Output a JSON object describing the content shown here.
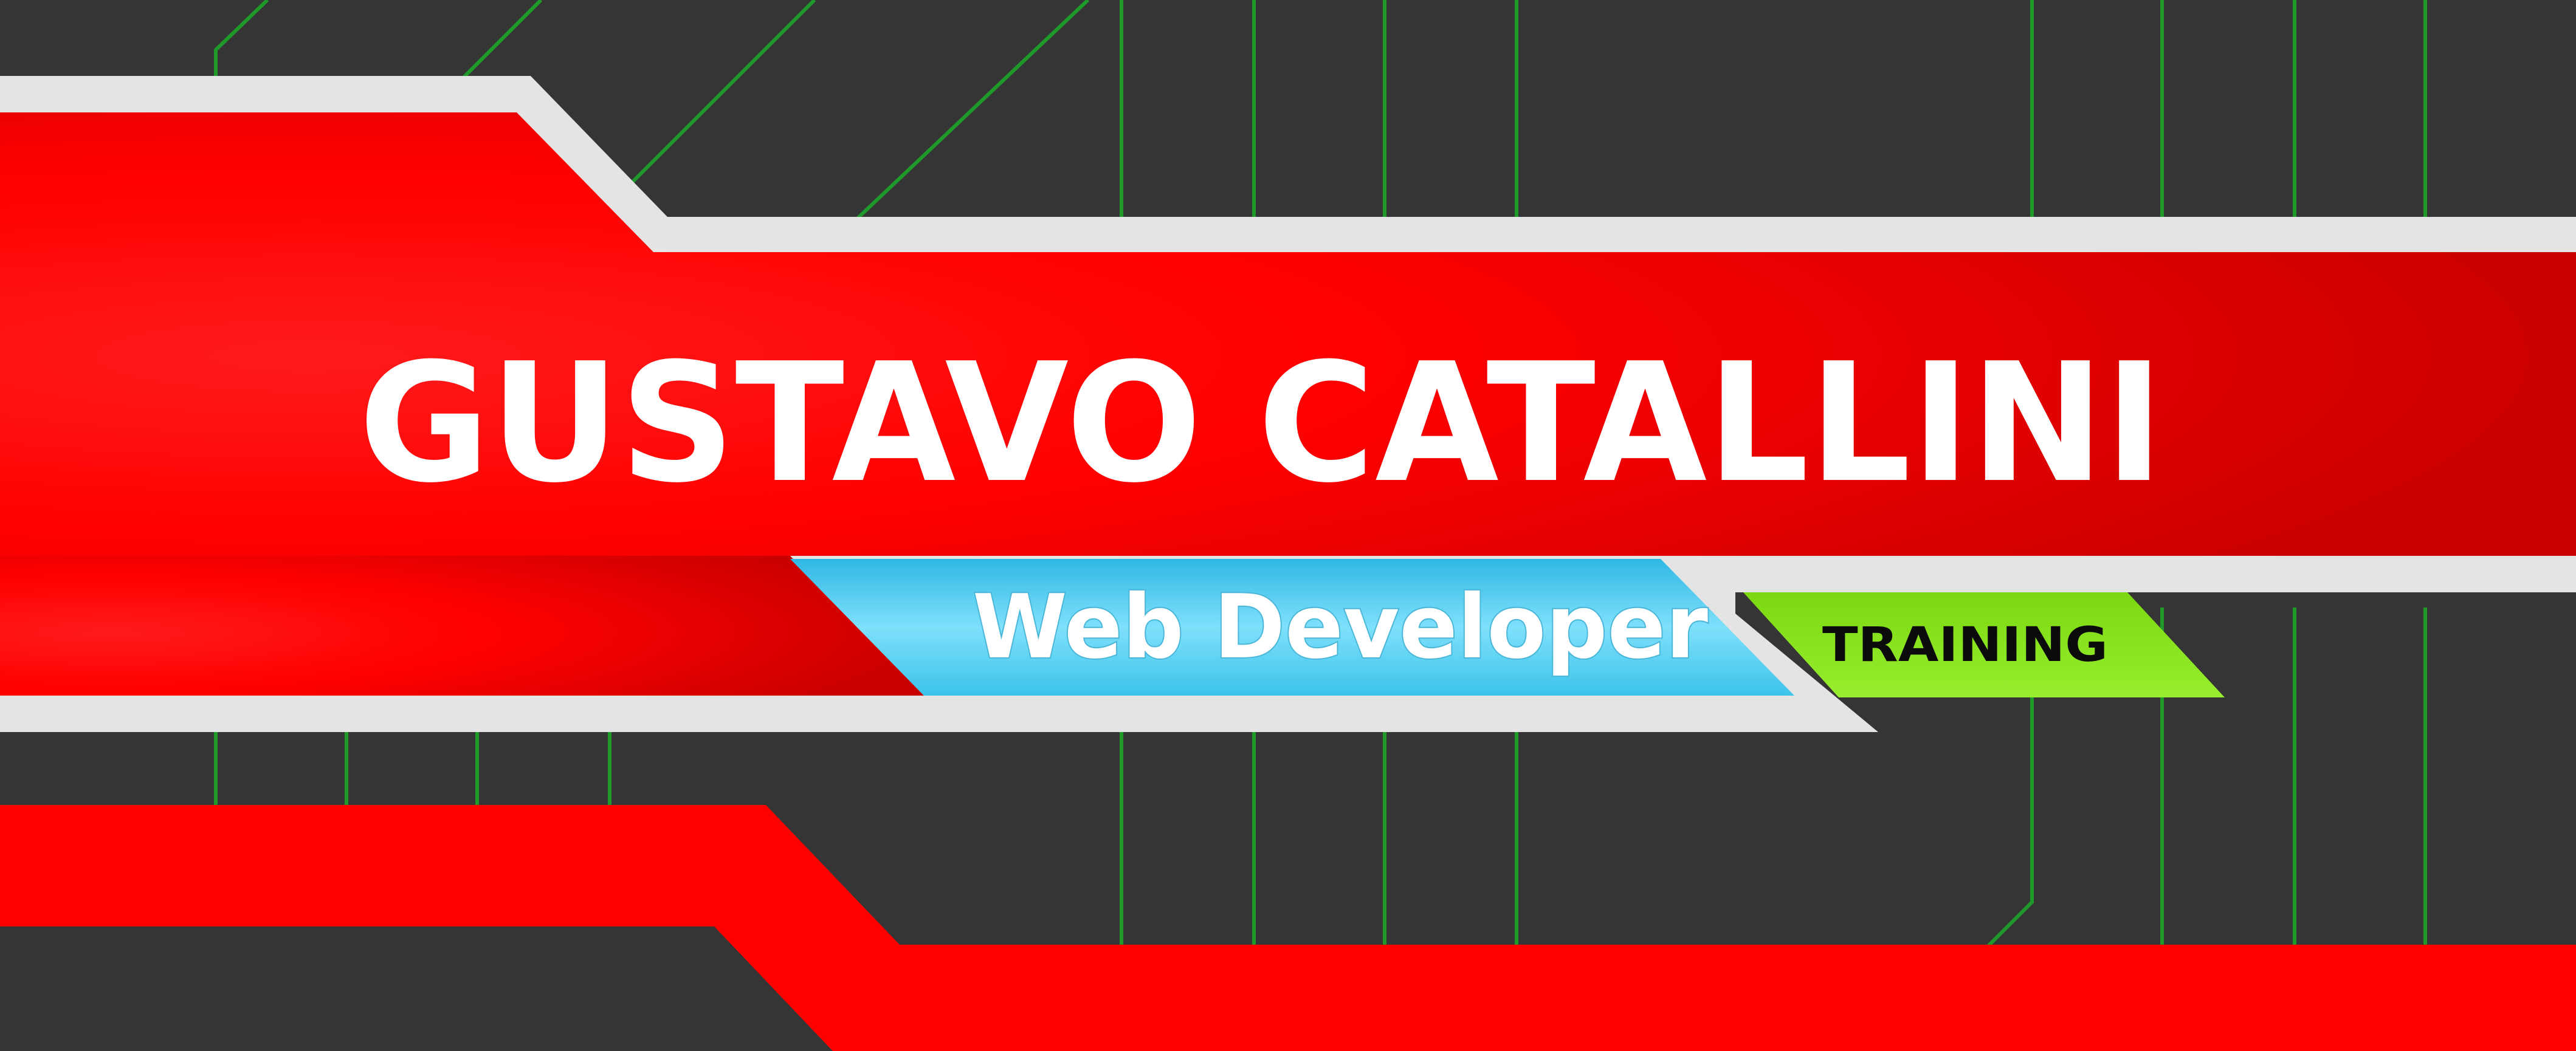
{
  "banner": {
    "name": "GUSTAVO CATALLINI",
    "role": "Web Developer",
    "badge": "TRAINING"
  },
  "colors": {
    "background": "#353535",
    "circuit_lines": "#1f9a2a",
    "primary_red": "#ff0000",
    "frame_gray": "#e4e4e4",
    "role_blue": "#5fd3f3",
    "badge_green": "#84e21a"
  }
}
